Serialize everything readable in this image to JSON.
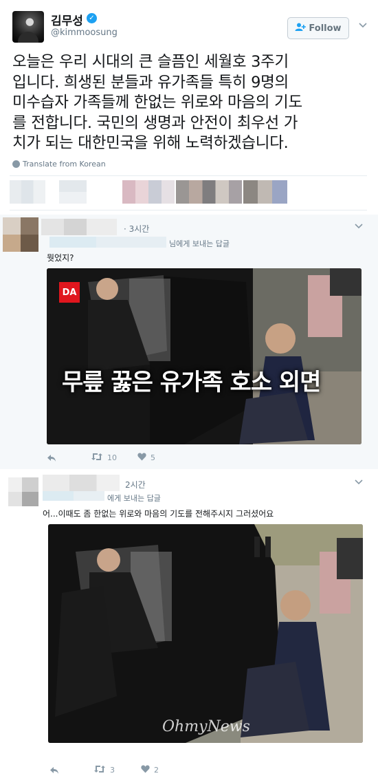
{
  "tweet": {
    "author_name": "김무성",
    "author_handle": "@kimmoosung",
    "follow_label": "Follow",
    "text_lines": [
      "오늘은 우리 시대의  큰 슬픔인 세월호 3주기",
      "입니다. 희생된 분들과 유가족들 특히 9명의",
      "미수습자 가족들께 한없는 위로와 마음의 기도",
      "를 전합니다. 국민의 생명과 안전이 최우선 가",
      "치가 되는 대한민국을 위해 노력하겠습니다."
    ],
    "translate_label": "Translate from Korean"
  },
  "replies": [
    {
      "time": "· 3시간",
      "reply_to_suffix": "님에게 보내는 답글",
      "text": "뭣었지?",
      "image_headline": "무릎 꿇은 유가족 호소 외면",
      "image_logo": "DA",
      "retweets": "10",
      "likes": "5"
    },
    {
      "time": "2시간",
      "reply_to_suffix": "에게 보내는 답글",
      "text": "어...이때도 좀 한없는 위로와 마음의 기도를 전해주시지 그러셨어요",
      "image_watermark": "OhmyNews",
      "retweets": "3",
      "likes": "2"
    }
  ],
  "icons": {
    "reply": "reply-icon",
    "retweet": "retweet-icon",
    "like": "heart-icon",
    "chevron": "chevron-down-icon",
    "verified": "verified-badge-icon",
    "globe": "globe-icon"
  },
  "colors": {
    "verified_blue": "#1da1f2",
    "text": "#14171a",
    "muted": "#657786",
    "reply_bg": "#f5f8fa",
    "logo_red": "#e0161e"
  }
}
